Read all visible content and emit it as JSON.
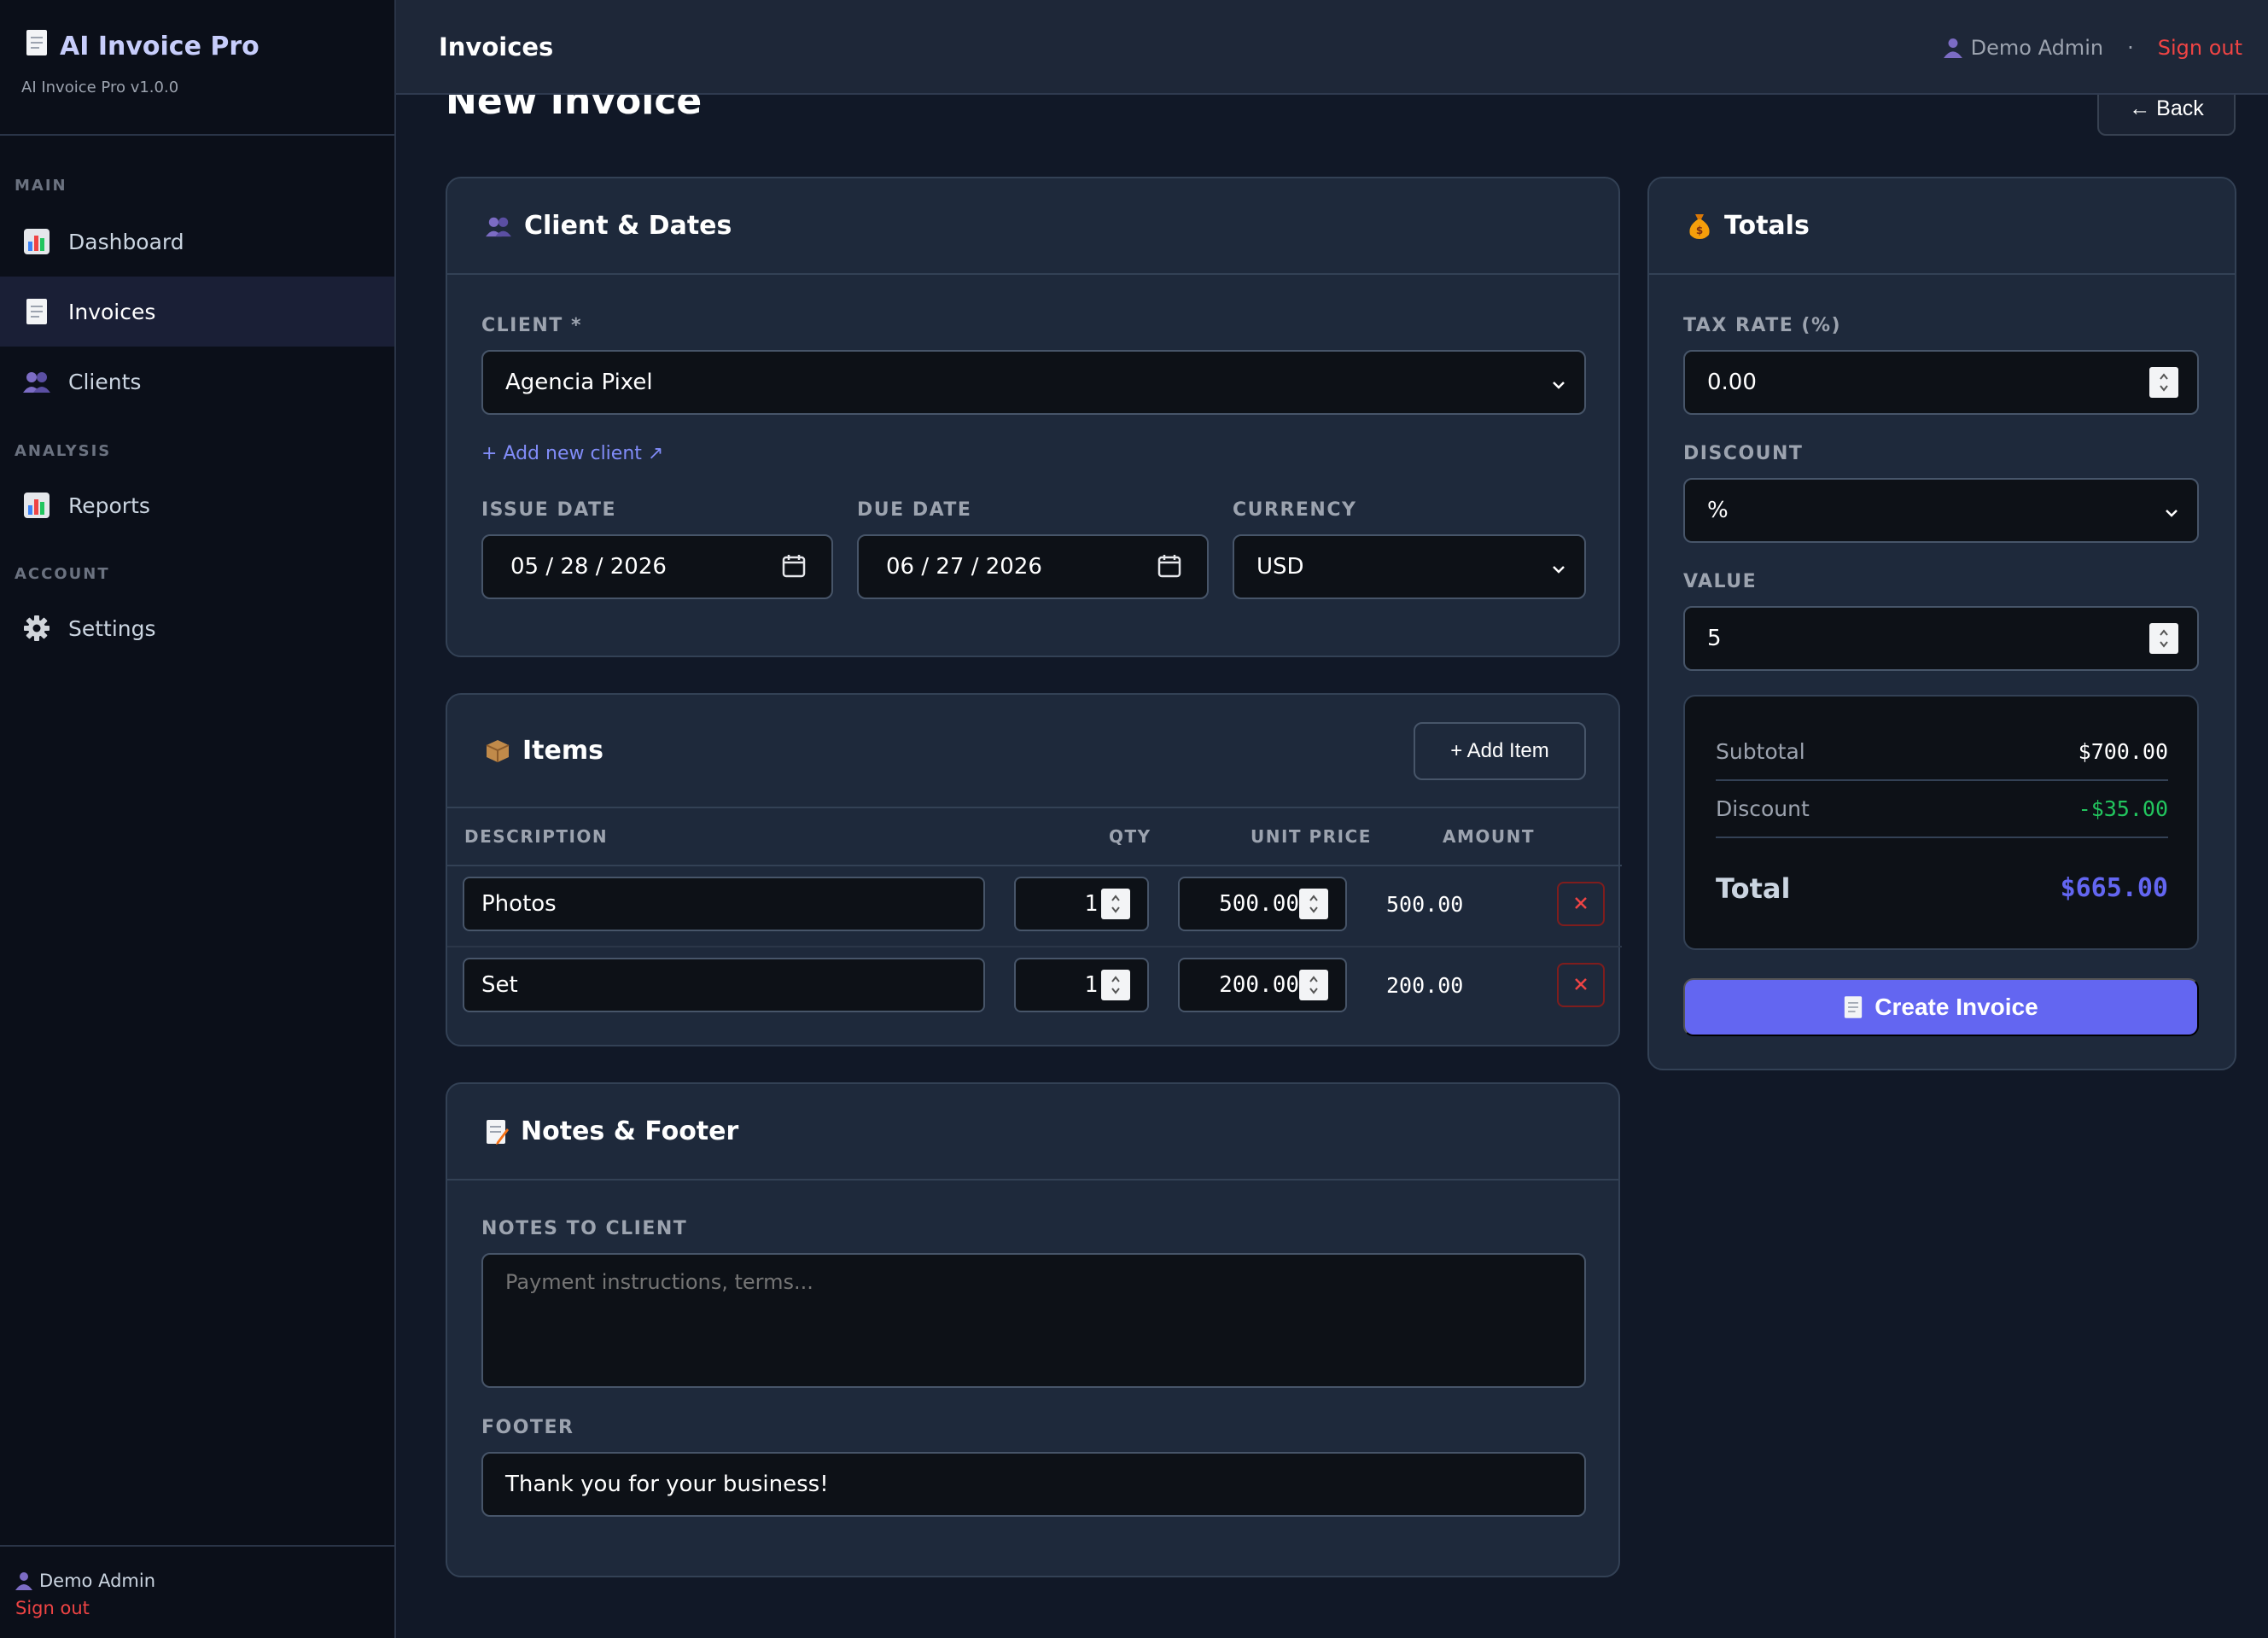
{
  "app": {
    "name": "AI Invoice Pro",
    "version": "AI Invoice Pro v1.0.0"
  },
  "sidebar": {
    "sections": [
      {
        "label": "MAIN"
      },
      {
        "label": "ANALYSIS"
      },
      {
        "label": "ACCOUNT"
      }
    ],
    "items": [
      {
        "label": "Dashboard",
        "icon": "bar-chart-icon"
      },
      {
        "label": "Invoices",
        "icon": "document-icon",
        "active": true
      },
      {
        "label": "Clients",
        "icon": "users-icon"
      },
      {
        "label": "Reports",
        "icon": "bar-chart-icon"
      },
      {
        "label": "Settings",
        "icon": "gear-icon"
      }
    ],
    "footer": {
      "user": "Demo Admin",
      "signout": "Sign out"
    }
  },
  "topbar": {
    "title": "Invoices",
    "user": "Demo Admin",
    "separator": "·",
    "signout": "Sign out"
  },
  "page": {
    "title": "New Invoice",
    "back_label": "← Back"
  },
  "client_dates": {
    "title": "Client & Dates",
    "client_label": "CLIENT *",
    "client_value": "Agencia Pixel",
    "add_client_link": "+ Add new client ↗",
    "issue_date_label": "ISSUE DATE",
    "issue_date_value": "05 / 28 / 2026",
    "due_date_label": "DUE DATE",
    "due_date_value": "06 / 27 / 2026",
    "currency_label": "CURRENCY",
    "currency_value": "USD"
  },
  "items": {
    "title": "Items",
    "add_item_label": "+ Add Item",
    "columns": [
      "DESCRIPTION",
      "QTY",
      "UNIT PRICE",
      "AMOUNT"
    ],
    "rows": [
      {
        "description": "Photos",
        "qty": "1",
        "unit_price": "500.00",
        "amount": "500.00"
      },
      {
        "description": "Set",
        "qty": "1",
        "unit_price": "200.00",
        "amount": "200.00"
      }
    ]
  },
  "notes": {
    "title": "Notes & Footer",
    "notes_label": "NOTES TO CLIENT",
    "notes_placeholder": "Payment instructions, terms...",
    "notes_value": "",
    "footer_label": "FOOTER",
    "footer_value": "Thank you for your business!"
  },
  "totals": {
    "title": "Totals",
    "tax_rate_label": "TAX RATE (%)",
    "tax_rate_value": "0.00",
    "discount_label": "DISCOUNT",
    "discount_type": "%",
    "value_label": "VALUE",
    "value_value": "5",
    "subtotal_label": "Subtotal",
    "subtotal_value": "$700.00",
    "discount_row_label": "Discount",
    "discount_row_value": "-$35.00",
    "total_label": "Total",
    "total_value": "$665.00",
    "create_label": "Create Invoice"
  },
  "colors": {
    "accent": "#6366f1",
    "danger": "#ef4444",
    "success": "#22c55e",
    "total": "#6366f1"
  }
}
